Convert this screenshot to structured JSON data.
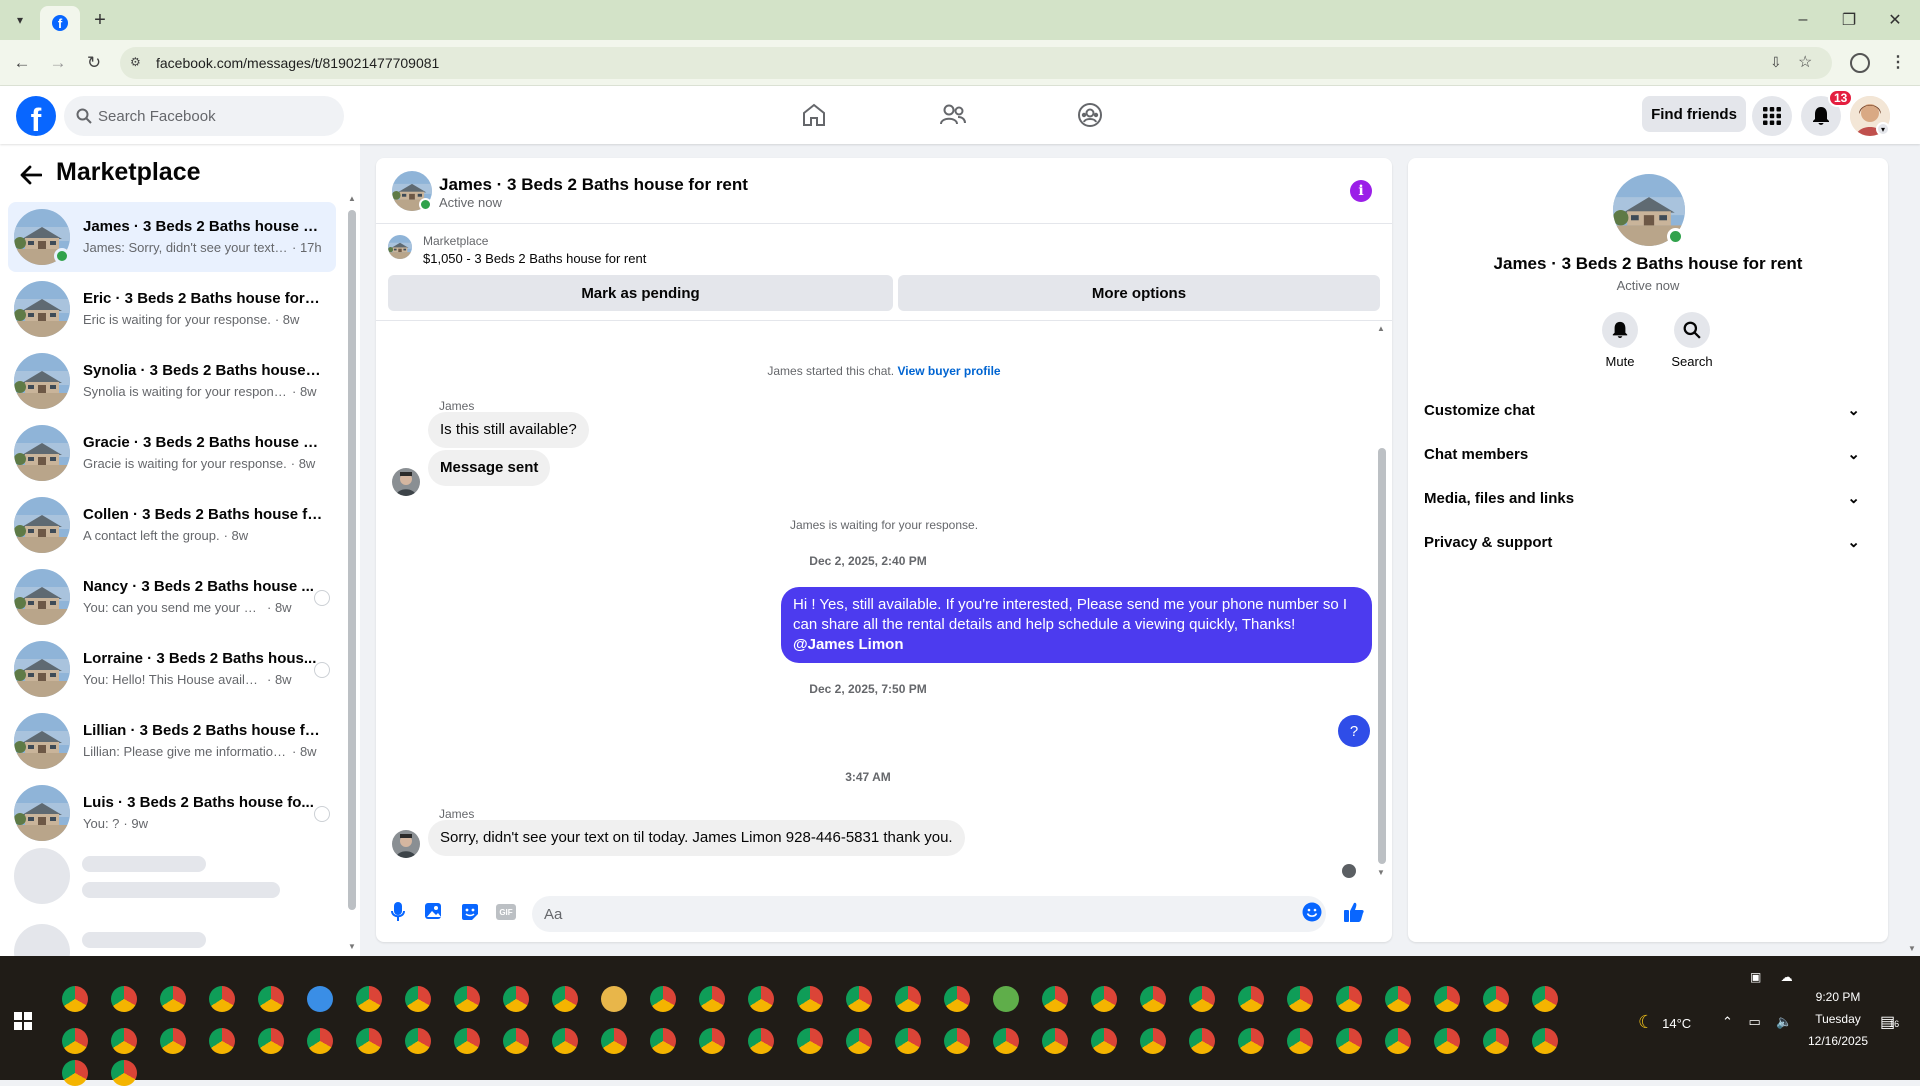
{
  "browser": {
    "url": "facebook.com/messages/t/819021477709081",
    "tab_icon": "facebook-icon"
  },
  "facebook": {
    "search_placeholder": "Search Facebook",
    "find_friends": "Find friends",
    "notification_count": "13",
    "accent": "#0866ff"
  },
  "left": {
    "title": "Marketplace",
    "conversations": [
      {
        "name": "James · 3 Beds 2 Baths house fo...",
        "preview": "James: Sorry, didn't see your text ...",
        "time": "· 17h",
        "active": true,
        "online": true
      },
      {
        "name": "Eric · 3 Beds 2 Baths house for r...",
        "preview": "Eric is waiting for your response.",
        "time": "· 8w"
      },
      {
        "name": "Synolia · 3 Beds 2 Baths house f...",
        "preview": "Synolia is waiting for your response.",
        "time": "· 8w"
      },
      {
        "name": "Gracie · 3 Beds 2 Baths house fo...",
        "preview": "Gracie is waiting for your response.",
        "time": "· 8w"
      },
      {
        "name": "Collen · 3 Beds 2 Baths house fo...",
        "preview": "A contact left the group.",
        "time": "· 8w"
      },
      {
        "name": "Nancy · 3 Beds 2 Baths house ...",
        "preview": "You: can you send me your num...",
        "time": "· 8w"
      },
      {
        "name": "Lorraine · 3 Beds 2 Baths hous...",
        "preview": "You: Hello! This House available ...",
        "time": "· 8w"
      },
      {
        "name": "Lillian · 3 Beds 2 Baths house for...",
        "preview": "Lillian: Please give me information ...",
        "time": "· 8w"
      },
      {
        "name": "Luis · 3 Beds 2 Baths house fo...",
        "preview": "You: ?",
        "time": "· 9w"
      }
    ]
  },
  "chat": {
    "title": "James · 3 Beds 2 Baths house for rent",
    "status": "Active now",
    "marketplace_label": "Marketplace",
    "listing": "$1,050 - 3 Beds 2 Baths house for rent",
    "mark_pending": "Mark as pending",
    "more_options": "More options",
    "started_text": "James started this chat.",
    "view_profile": "View buyer profile",
    "sender": "James",
    "msg1": "Is this still available?",
    "msg2": "Message sent",
    "waiting": "James is waiting for your response.",
    "ts1": "Dec 2, 2025, 2:40 PM",
    "out_msg": "Hi ! Yes, still available. If you're interested, Please send me your phone number so I can share all the rental details and help schedule a viewing quickly, Thanks!",
    "mention": "@James Limon",
    "ts2": "Dec 2, 2025, 7:50 PM",
    "out_q": "?",
    "ts3": "3:47 AM",
    "sender2": "James",
    "msg3": "Sorry, didn't see your text on til today. James Limon 928-446-5831 thank you.",
    "input_placeholder": "Aa"
  },
  "right": {
    "name": "James · 3 Beds 2 Baths house for rent",
    "status": "Active now",
    "mute": "Mute",
    "search": "Search",
    "sections": [
      "Customize chat",
      "Chat members",
      "Media, files and links",
      "Privacy & support"
    ]
  },
  "taskbar": {
    "time": "9:20 PM",
    "day": "Tuesday",
    "date": "12/16/2025",
    "temp": "14°C",
    "notif": "16"
  }
}
